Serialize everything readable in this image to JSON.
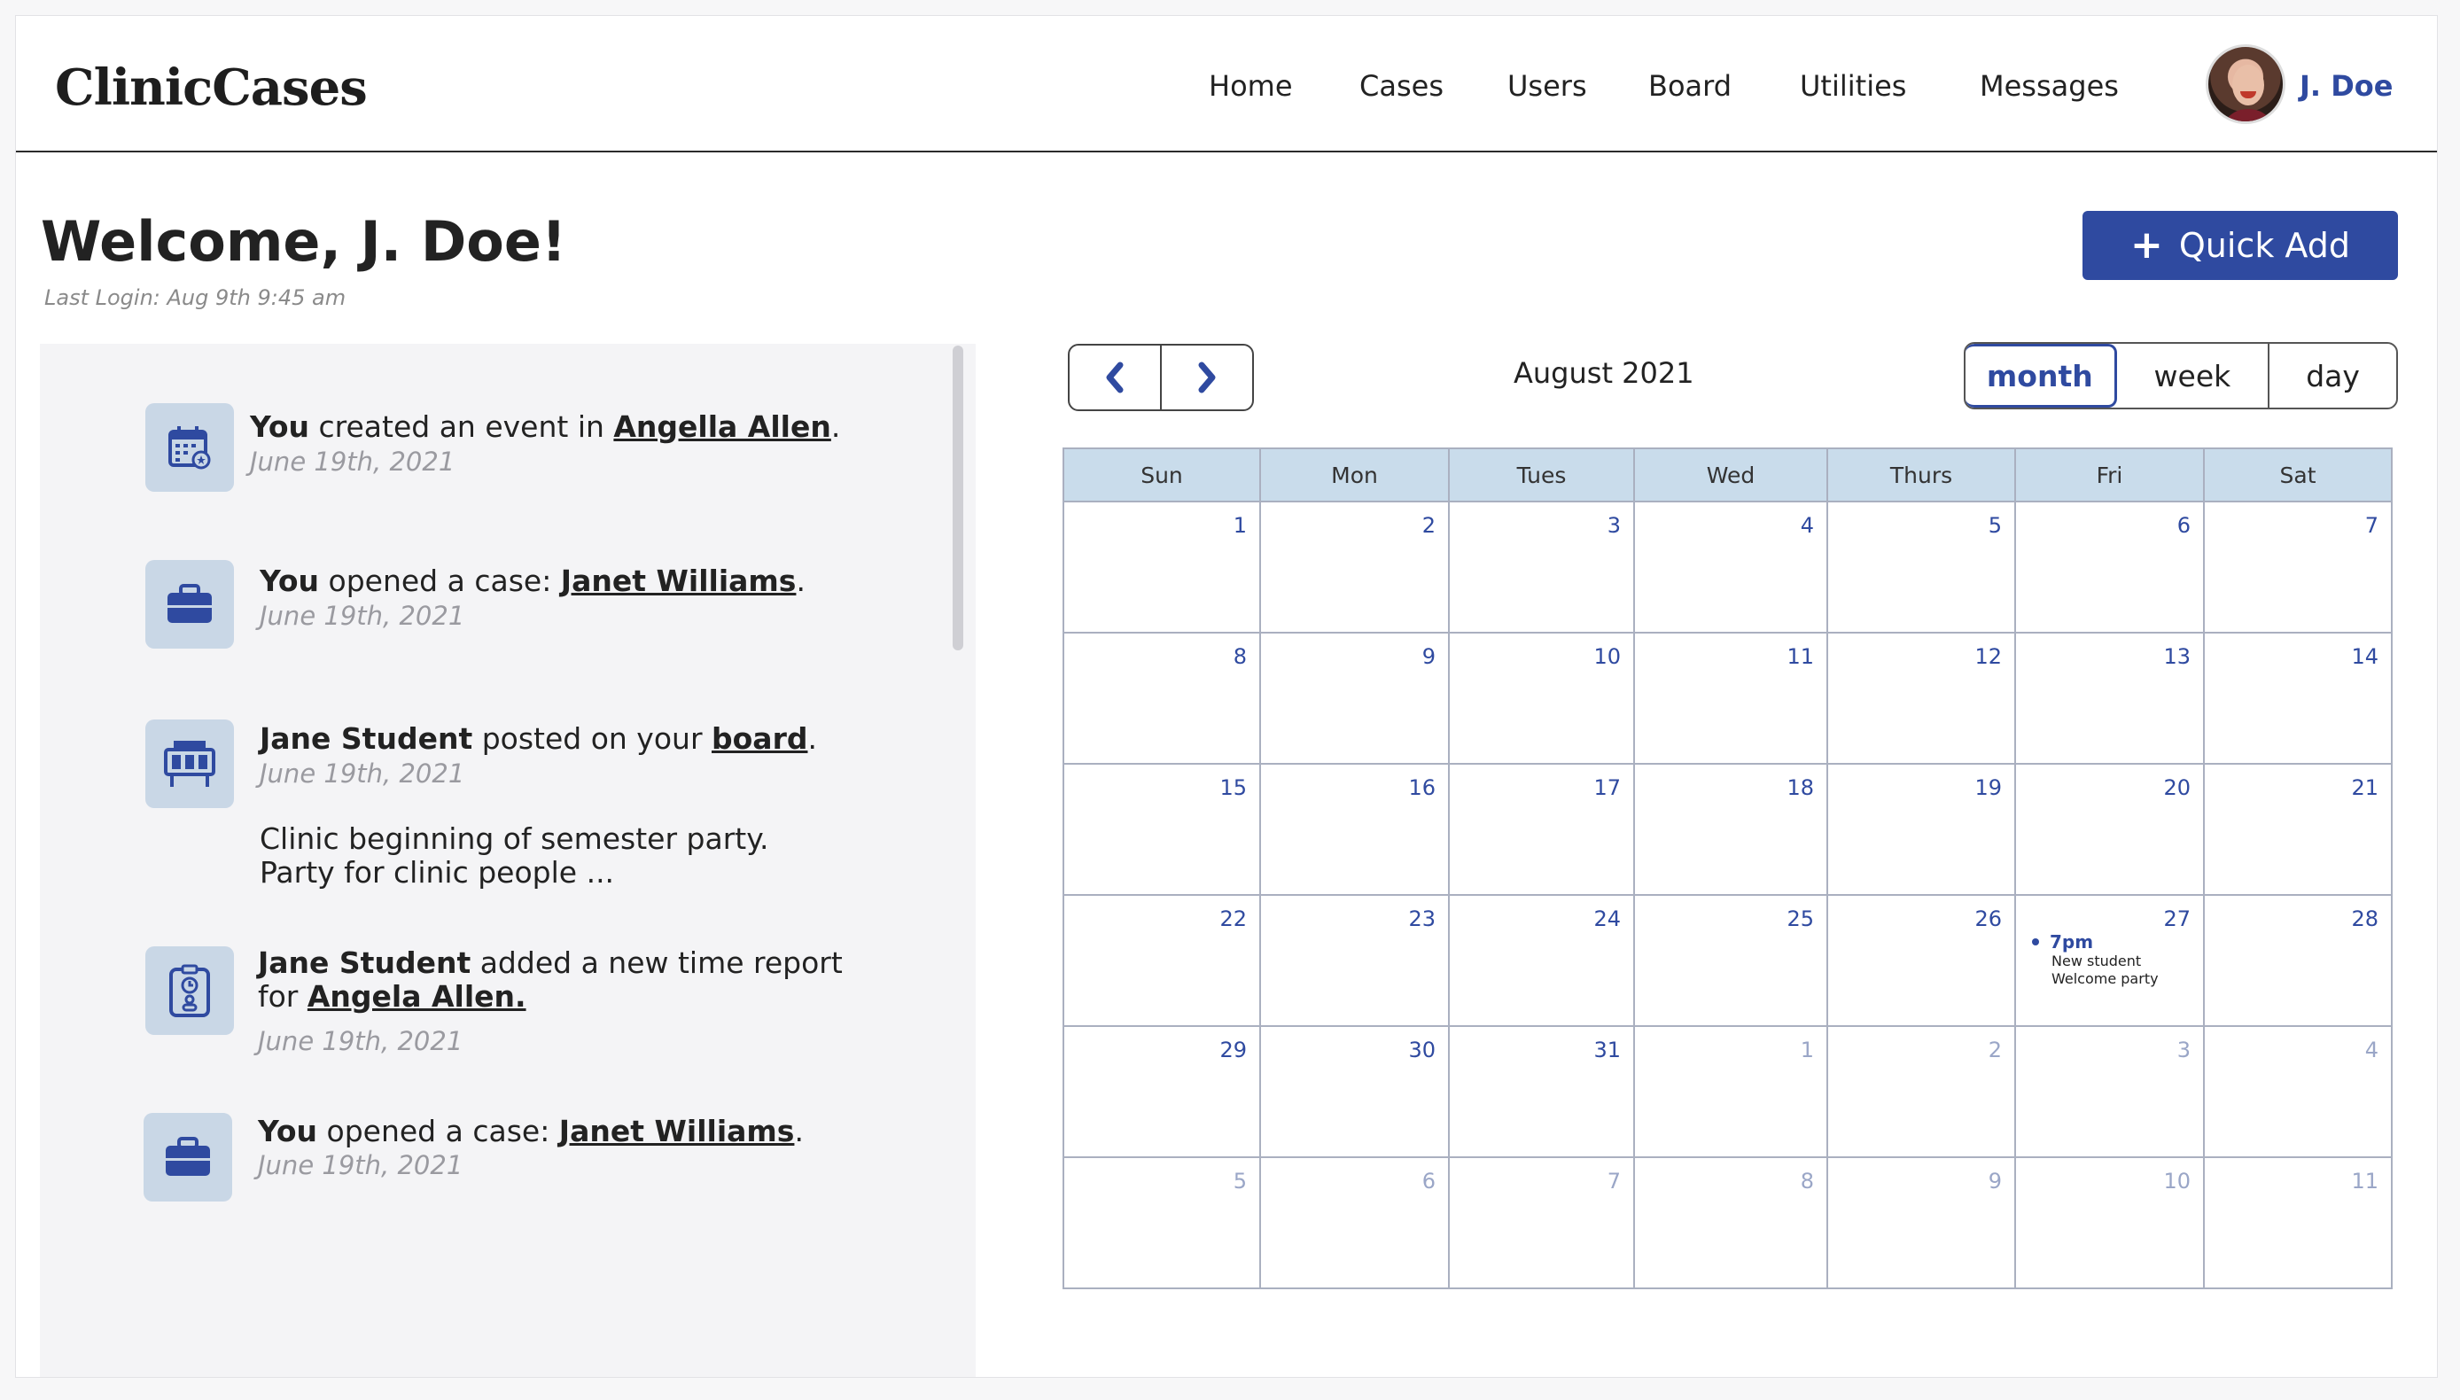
{
  "header": {
    "logo": "ClinicCases",
    "nav": [
      "Home",
      "Cases",
      "Users",
      "Board",
      "Utilities",
      "Messages"
    ],
    "user_name": "J. Doe"
  },
  "welcome": {
    "title": "Welcome, J. Doe!",
    "last_login": "Last Login: Aug 9th 9:45 am",
    "quick_add_label": "Quick Add",
    "quick_add_icon": "plus-icon"
  },
  "feed": [
    {
      "icon": "calendar-icon",
      "actor": "You",
      "text": " created an event in ",
      "link": "Angella Allen",
      "end": ".",
      "date": "June 19th, 2021"
    },
    {
      "icon": "briefcase-icon",
      "actor": "You",
      "text": " opened a case: ",
      "link": "Janet Williams",
      "end": ".",
      "date": "June 19th, 2021"
    },
    {
      "icon": "board-icon",
      "actor": "Jane Student",
      "text": " posted on your ",
      "link": "board",
      "end": ".",
      "date": "June 19th, 2021",
      "body": [
        "Clinic beginning of semester party.",
        "Party for clinic people ..."
      ]
    },
    {
      "icon": "time-report-icon",
      "actor": "Jane Student",
      "text": " added a new time report",
      "line2": "for ",
      "link": "Angela Allen.",
      "date": "June 19th, 2021"
    },
    {
      "icon": "briefcase-icon",
      "actor": "You",
      "text": " opened a case: ",
      "link": "Janet Williams",
      "end": ".",
      "date": "June 19th, 2021"
    }
  ],
  "calendar": {
    "month_title": "August 2021",
    "views": [
      "month",
      "week",
      "day"
    ],
    "active_view": "month",
    "weekdays": [
      "Sun",
      "Mon",
      "Tues",
      "Wed",
      "Thurs",
      "Fri",
      "Sat"
    ],
    "weeks": [
      [
        "1",
        "2",
        "3",
        "4",
        "5",
        "6",
        "7"
      ],
      [
        "8",
        "9",
        "10",
        "11",
        "12",
        "13",
        "14"
      ],
      [
        "15",
        "16",
        "17",
        "18",
        "19",
        "20",
        "21"
      ],
      [
        "22",
        "23",
        "24",
        "25",
        "26",
        "27",
        "28"
      ],
      [
        "29",
        "30",
        "31",
        "1",
        "2",
        "3",
        "4"
      ],
      [
        "5",
        "6",
        "7",
        "8",
        "9",
        "10",
        "11"
      ]
    ],
    "event": {
      "day": "27",
      "time": "7pm",
      "title_line1": "New student",
      "title_line2": "Welcome party"
    }
  }
}
